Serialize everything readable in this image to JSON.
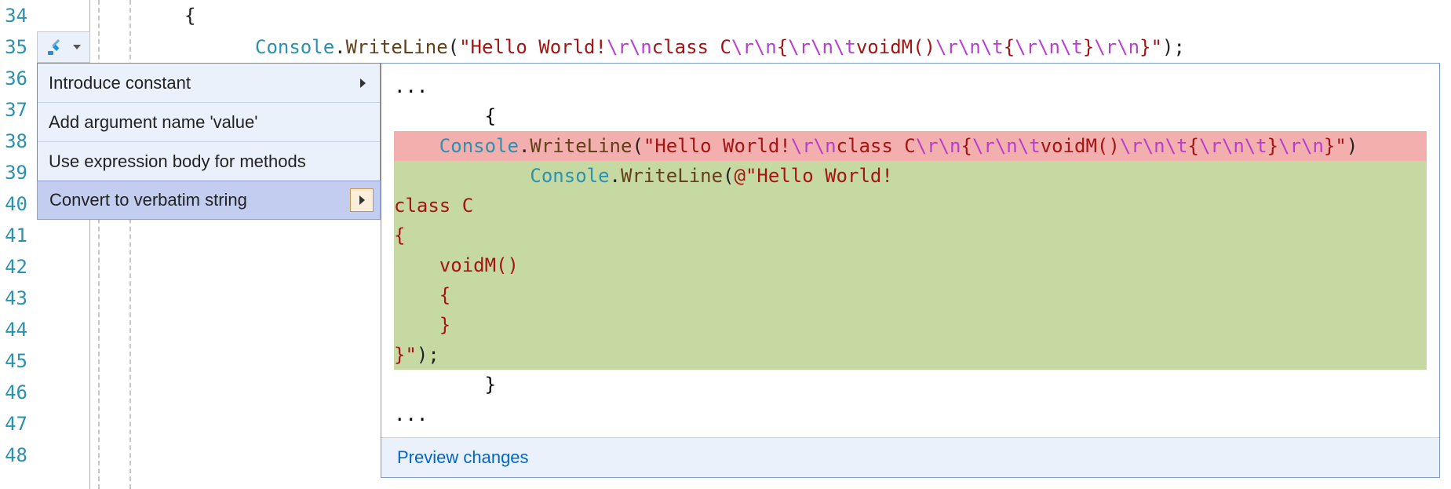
{
  "line_numbers": [
    "34",
    "35",
    "36",
    "37",
    "38",
    "39",
    "40",
    "41",
    "42",
    "43",
    "44",
    "45",
    "46",
    "47",
    "48"
  ],
  "code": {
    "line34": {
      "tokens": [
        {
          "t": "{",
          "c": "tk-brace"
        }
      ]
    },
    "line35": {
      "tokens": [
        {
          "t": "Console",
          "c": "tk-type"
        },
        {
          "t": ".",
          "c": "tk-dot"
        },
        {
          "t": "WriteLine",
          "c": "tk-method"
        },
        {
          "t": "(",
          "c": "tk-paren"
        },
        {
          "t": "\"Hello World!",
          "c": "tk-str"
        },
        {
          "t": "\\r\\n",
          "c": "tk-esc"
        },
        {
          "t": "class C",
          "c": "tk-str"
        },
        {
          "t": "\\r\\n",
          "c": "tk-esc"
        },
        {
          "t": "{",
          "c": "tk-str"
        },
        {
          "t": "\\r\\n\\t",
          "c": "tk-esc"
        },
        {
          "t": "voidM()",
          "c": "tk-str"
        },
        {
          "t": "\\r\\n\\t",
          "c": "tk-esc"
        },
        {
          "t": "{",
          "c": "tk-str"
        },
        {
          "t": "\\r\\n\\t",
          "c": "tk-esc"
        },
        {
          "t": "}",
          "c": "tk-str"
        },
        {
          "t": "\\r\\n",
          "c": "tk-esc"
        },
        {
          "t": "}\"",
          "c": "tk-str"
        },
        {
          "t": ");",
          "c": "tk-punc"
        }
      ]
    }
  },
  "menu": {
    "items": [
      {
        "label": "Introduce constant",
        "has_submenu": true,
        "selected": false
      },
      {
        "label": "Add argument name 'value'",
        "has_submenu": false,
        "selected": false
      },
      {
        "label": "Use expression body for methods",
        "has_submenu": false,
        "selected": false
      },
      {
        "label": "Convert to verbatim string",
        "has_submenu": true,
        "selected": true
      }
    ]
  },
  "preview": {
    "ellipsis_top": "...",
    "before_brace": "        {",
    "del_line": {
      "tokens": [
        {
          "t": "    ",
          "c": ""
        },
        {
          "t": "Console",
          "c": "tk-type"
        },
        {
          "t": ".",
          "c": "tk-dot"
        },
        {
          "t": "WriteLine",
          "c": "tk-method"
        },
        {
          "t": "(",
          "c": "tk-paren"
        },
        {
          "t": "\"Hello World!",
          "c": "tk-str"
        },
        {
          "t": "\\r\\n",
          "c": "tk-esc"
        },
        {
          "t": "class C",
          "c": "tk-str"
        },
        {
          "t": "\\r\\n",
          "c": "tk-esc"
        },
        {
          "t": "{",
          "c": "tk-str"
        },
        {
          "t": "\\r\\n\\t",
          "c": "tk-esc"
        },
        {
          "t": "voidM()",
          "c": "tk-str"
        },
        {
          "t": "\\r\\n\\t",
          "c": "tk-esc"
        },
        {
          "t": "{",
          "c": "tk-str"
        },
        {
          "t": "\\r\\n\\t",
          "c": "tk-esc"
        },
        {
          "t": "}",
          "c": "tk-str"
        },
        {
          "t": "\\r\\n",
          "c": "tk-esc"
        },
        {
          "t": "}\"",
          "c": "tk-str"
        },
        {
          "t": ")",
          "c": "tk-punc"
        }
      ]
    },
    "add_lines": [
      {
        "tokens": [
          {
            "t": "            ",
            "c": ""
          },
          {
            "t": "Console",
            "c": "tk-type"
          },
          {
            "t": ".",
            "c": "tk-dot"
          },
          {
            "t": "WriteLine",
            "c": "tk-method"
          },
          {
            "t": "(",
            "c": "tk-paren"
          },
          {
            "t": "@\"Hello World!",
            "c": "tk-str"
          }
        ]
      },
      {
        "tokens": [
          {
            "t": "class C",
            "c": "tk-str"
          }
        ]
      },
      {
        "tokens": [
          {
            "t": "{",
            "c": "tk-str"
          }
        ]
      },
      {
        "tokens": [
          {
            "t": "    voidM()",
            "c": "tk-str"
          }
        ]
      },
      {
        "tokens": [
          {
            "t": "    {",
            "c": "tk-str"
          }
        ]
      },
      {
        "tokens": [
          {
            "t": "    }",
            "c": "tk-str"
          }
        ]
      },
      {
        "tokens": [
          {
            "t": "}\"",
            "c": "tk-str"
          },
          {
            "t": ");",
            "c": "tk-punc"
          }
        ]
      }
    ],
    "after_brace": "        }",
    "ellipsis_bottom": "...",
    "footer": "Preview changes"
  }
}
